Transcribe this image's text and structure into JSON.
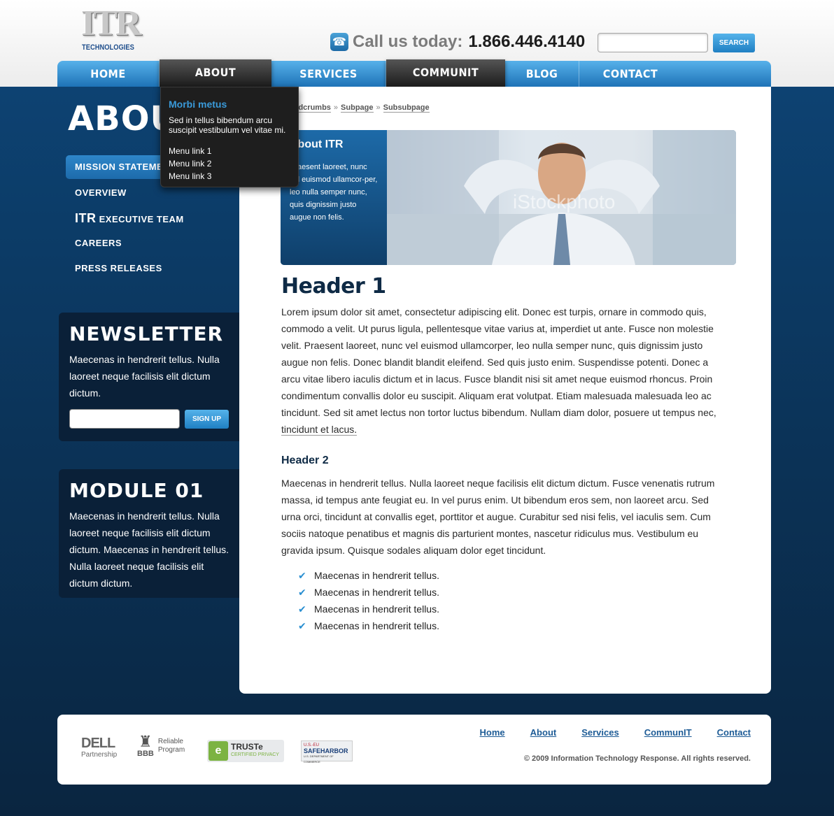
{
  "header": {
    "logo_text": "ITR",
    "logo_sub": "TECHNOLOGIES",
    "call_label": "Call us today:",
    "phone": "1.866.446.4140",
    "search_placeholder": "",
    "search_button": "SEARCH"
  },
  "nav": {
    "items": [
      {
        "label": "HOME"
      },
      {
        "label": "ABOUT"
      },
      {
        "label": "SERVICES"
      },
      {
        "label": "COMMUNIT"
      },
      {
        "label": "BLOG"
      },
      {
        "label": "CONTACT"
      }
    ]
  },
  "dropdown": {
    "title": "Morbi metus",
    "text": "Sed in tellus bibendum arcu suscipit vestibulum vel vitae mi.",
    "links": [
      "Menu link 1",
      "Menu link 2",
      "Menu link 3"
    ]
  },
  "sidebar": {
    "page_heading": "ABOUT",
    "items": [
      {
        "label": "MISSION STATEMENT"
      },
      {
        "label": "OVERVIEW"
      },
      {
        "label_big": "ITR",
        "label": " EXECUTIVE TEAM"
      },
      {
        "label": "CAREERS"
      },
      {
        "label": "PRESS RELEASES"
      }
    ]
  },
  "newsletter": {
    "title": "NEWSLETTER",
    "text": "Maecenas in hendrerit tellus. Nulla laoreet neque facilisis elit dictum dictum.",
    "input_placeholder": "",
    "button": "SIGN UP"
  },
  "module": {
    "title": "MODULE 01",
    "text": "Maecenas in hendrerit tellus. Nulla laoreet neque facilisis elit dictum dictum. Maecenas in hendrerit tellus. Nulla laoreet neque facilisis elit dictum dictum."
  },
  "breadcrumb": {
    "items": [
      "Breadcrumbs",
      "Subpage",
      "Subsubpage"
    ],
    "separator": "»"
  },
  "hero": {
    "title": "About ITR",
    "text": "Praesent laoreet, nunc vel euismod ullamcor-per, leo nulla semper nunc, quis dignissim justo augue non felis.",
    "watermark": "iStockphoto"
  },
  "content": {
    "h1": "Header 1",
    "p1": "Lorem ipsum dolor sit amet, consectetur adipiscing elit. Donec est turpis, ornare in commodo quis, commodo a velit. Ut purus ligula, pellentesque vitae varius at, imperdiet ut ante. Fusce non molestie velit. Praesent laoreet, nunc vel euismod ullamcorper, leo nulla semper nunc, quis dignissim justo augue non felis. Donec blandit blandit eleifend. Sed quis justo enim. Suspendisse potenti. Donec a arcu vitae libero iaculis dictum et in lacus. Fusce blandit nisi sit amet neque euismod rhoncus. Proin condimentum convallis dolor eu suscipit. Aliquam erat volutpat. Etiam malesuada malesuada leo ac tincidunt. Sed sit amet lectus non tortor luctus bibendum. Nullam diam dolor, posuere ut tempus nec,",
    "p1_link": "tincidunt et lacus.",
    "h2": "Header 2",
    "p2": "Maecenas in hendrerit tellus. Nulla laoreet neque facilisis elit dictum dictum. Fusce venenatis rutrum massa, id tempus ante feugiat eu. In vel purus enim. Ut bibendum eros sem, non laoreet arcu. Sed urna orci, tincidunt at convallis eget, porttitor et augue. Curabitur sed nisi felis, vel iaculis sem. Cum sociis natoque penatibus et magnis dis parturient montes, nascetur ridiculus mus. Vestibulum eu gravida ipsum. Quisque sodales aliquam dolor eget tincidunt.",
    "checklist": [
      "Maecenas in hendrerit tellus.",
      "Maecenas in hendrerit tellus.",
      "Maecenas in hendrerit tellus.",
      "Maecenas in hendrerit tellus."
    ]
  },
  "footer": {
    "links": [
      "Home",
      "About",
      "Services",
      "CommunIT",
      "Contact"
    ],
    "copyright": "© 2009 Information Technology Response. All rights reserved.",
    "badges": {
      "dell": {
        "mark": "DELL",
        "sub": "Partnership"
      },
      "bbb": {
        "mark": "BBB",
        "line1": "Reliable",
        "line2": "Program"
      },
      "truste": {
        "mark": "TRUSTe",
        "sub": "CERTIFIED PRIVACY"
      },
      "safeharbor": {
        "top": "U.S.-EU",
        "mark": "SAFEHARBOR",
        "sub": "U.S. DEPARTMENT OF COMMERCE"
      }
    }
  },
  "colors": {
    "accent": "#2a86c9",
    "dark_nav": "#1c1c1c",
    "heading": "#0e2a45",
    "link": "#1e5c96"
  }
}
